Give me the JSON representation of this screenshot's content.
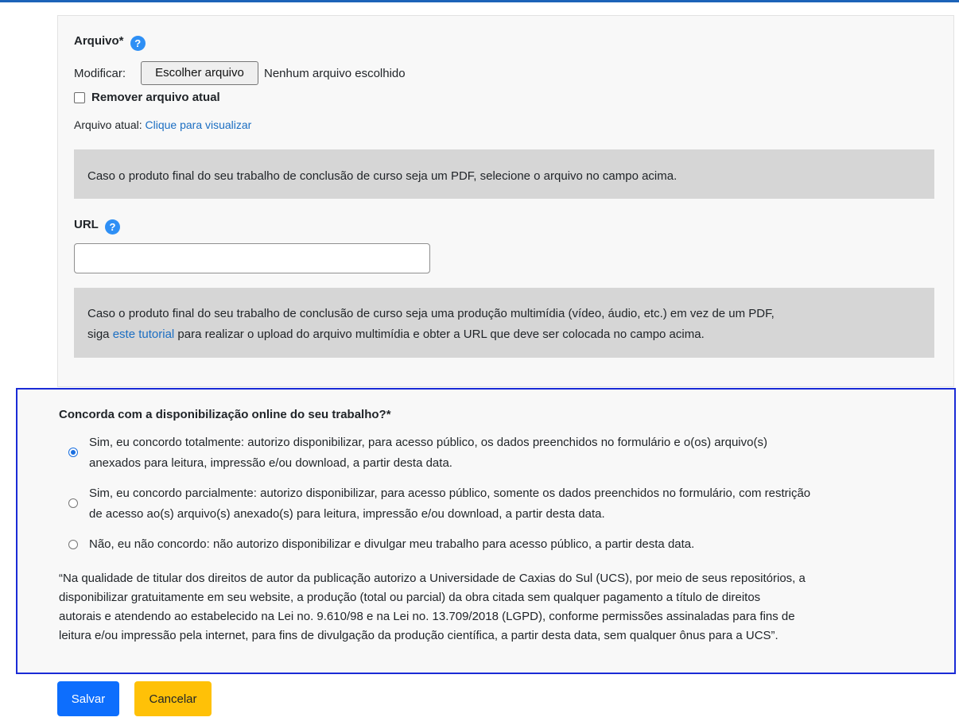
{
  "file_section": {
    "label": "Arquivo*",
    "help": "?",
    "modify_label": "Modificar:",
    "choose_button": "Escolher arquivo",
    "no_file": "Nenhum arquivo escolhido",
    "remove_label": "Remover arquivo atual",
    "current_label": "Arquivo atual:",
    "current_link": "Clique para visualizar",
    "note": "Caso o produto final do seu trabalho de conclusão de curso seja um PDF, selecione o arquivo no campo acima."
  },
  "url_section": {
    "label": "URL",
    "help": "?",
    "value": "",
    "note_part1": "Caso o produto final do seu trabalho de conclusão de curso seja uma produção multimídia (vídeo, áudio, etc.) em vez de um PDF,",
    "note_part2_before": "siga",
    "note_link": "este tutorial",
    "note_part2_after": "para realizar o upload do arquivo multimídia e obter a URL que deve ser colocada no campo acima."
  },
  "consent": {
    "question": "Concorda com a disponibilização online do seu trabalho?*",
    "selected_index": 0,
    "options": [
      {
        "line1": "Sim, eu concordo totalmente: autorizo disponibilizar, para acesso público, os dados preenchidos no formulário e o(os) arquivo(s)",
        "line2": "anexados para leitura, impressão e/ou download, a partir desta data."
      },
      {
        "line1": "Sim, eu concordo parcialmente: autorizo disponibilizar, para acesso público, somente os dados preenchidos no formulário, com restrição",
        "line2": "de acesso ao(s) arquivo(s) anexado(s) para leitura, impressão e/ou download, a partir desta data."
      },
      {
        "line1": "Não, eu não concordo: não autorizo disponibilizar e divulgar meu trabalho para acesso público, a partir desta data.",
        "line2": ""
      }
    ],
    "legal_lines": [
      "“Na qualidade de titular dos direitos de autor da publicação autorizo a Universidade de Caxias do Sul (UCS), por meio de seus repositórios, a",
      "disponibilizar gratuitamente em seu website, a produção (total ou parcial) da obra citada sem qualquer pagamento a título de direitos",
      "autorais e atendendo ao estabelecido na Lei no. 9.610/98 e na Lei no. 13.709/2018 (LGPD), conforme permissões assinaladas para fins de",
      "leitura e/ou impressão pela internet, para fins de divulgação da produção científica, a partir desta data, sem qualquer ônus para a UCS”."
    ]
  },
  "actions": {
    "save": "Salvar",
    "cancel": "Cancelar"
  },
  "colors": {
    "primary": "#0d6efd",
    "warning": "#ffc107",
    "highlight_border": "#1a2bd6",
    "help_icon": "#2e8ff5"
  }
}
